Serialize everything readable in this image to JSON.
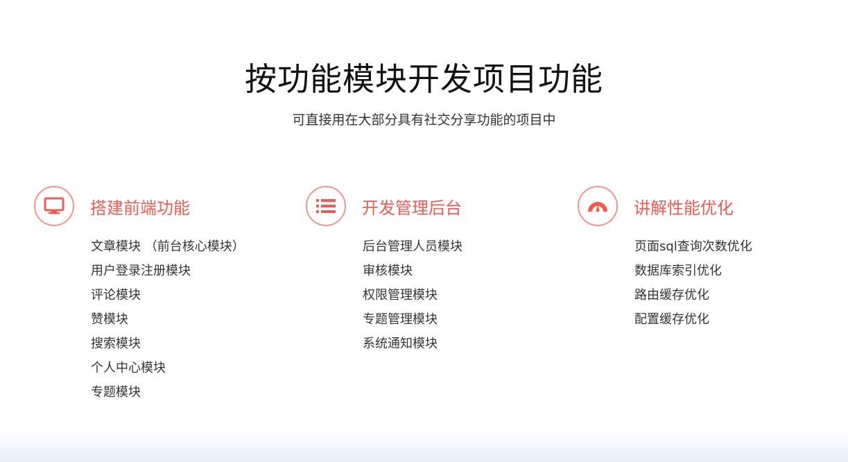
{
  "header": {
    "title": "按功能模块开发项目功能",
    "subtitle": "可直接用在大部分具有社交分享功能的项目中"
  },
  "colors": {
    "accent": "#ef5b50",
    "icon_border": "#f3938a",
    "text": "#333333",
    "title": "#111111"
  },
  "features": [
    {
      "icon": "monitor-icon",
      "title": "搭建前端功能",
      "items": [
        "文章模块 （前台核心模块）",
        "用户登录注册模块",
        "评论模块",
        "赞模块",
        "搜索模块",
        "个人中心模块",
        "专题模块"
      ]
    },
    {
      "icon": "list-icon",
      "title": "开发管理后台",
      "items": [
        "后台管理人员模块",
        "审核模块",
        "权限管理模块",
        "专题管理模块",
        "系统通知模块"
      ]
    },
    {
      "icon": "gauge-icon",
      "title": "讲解性能优化",
      "items": [
        "页面sql查询次数优化",
        "数据库索引优化",
        "路由缓存优化",
        "配置缓存优化"
      ]
    }
  ]
}
